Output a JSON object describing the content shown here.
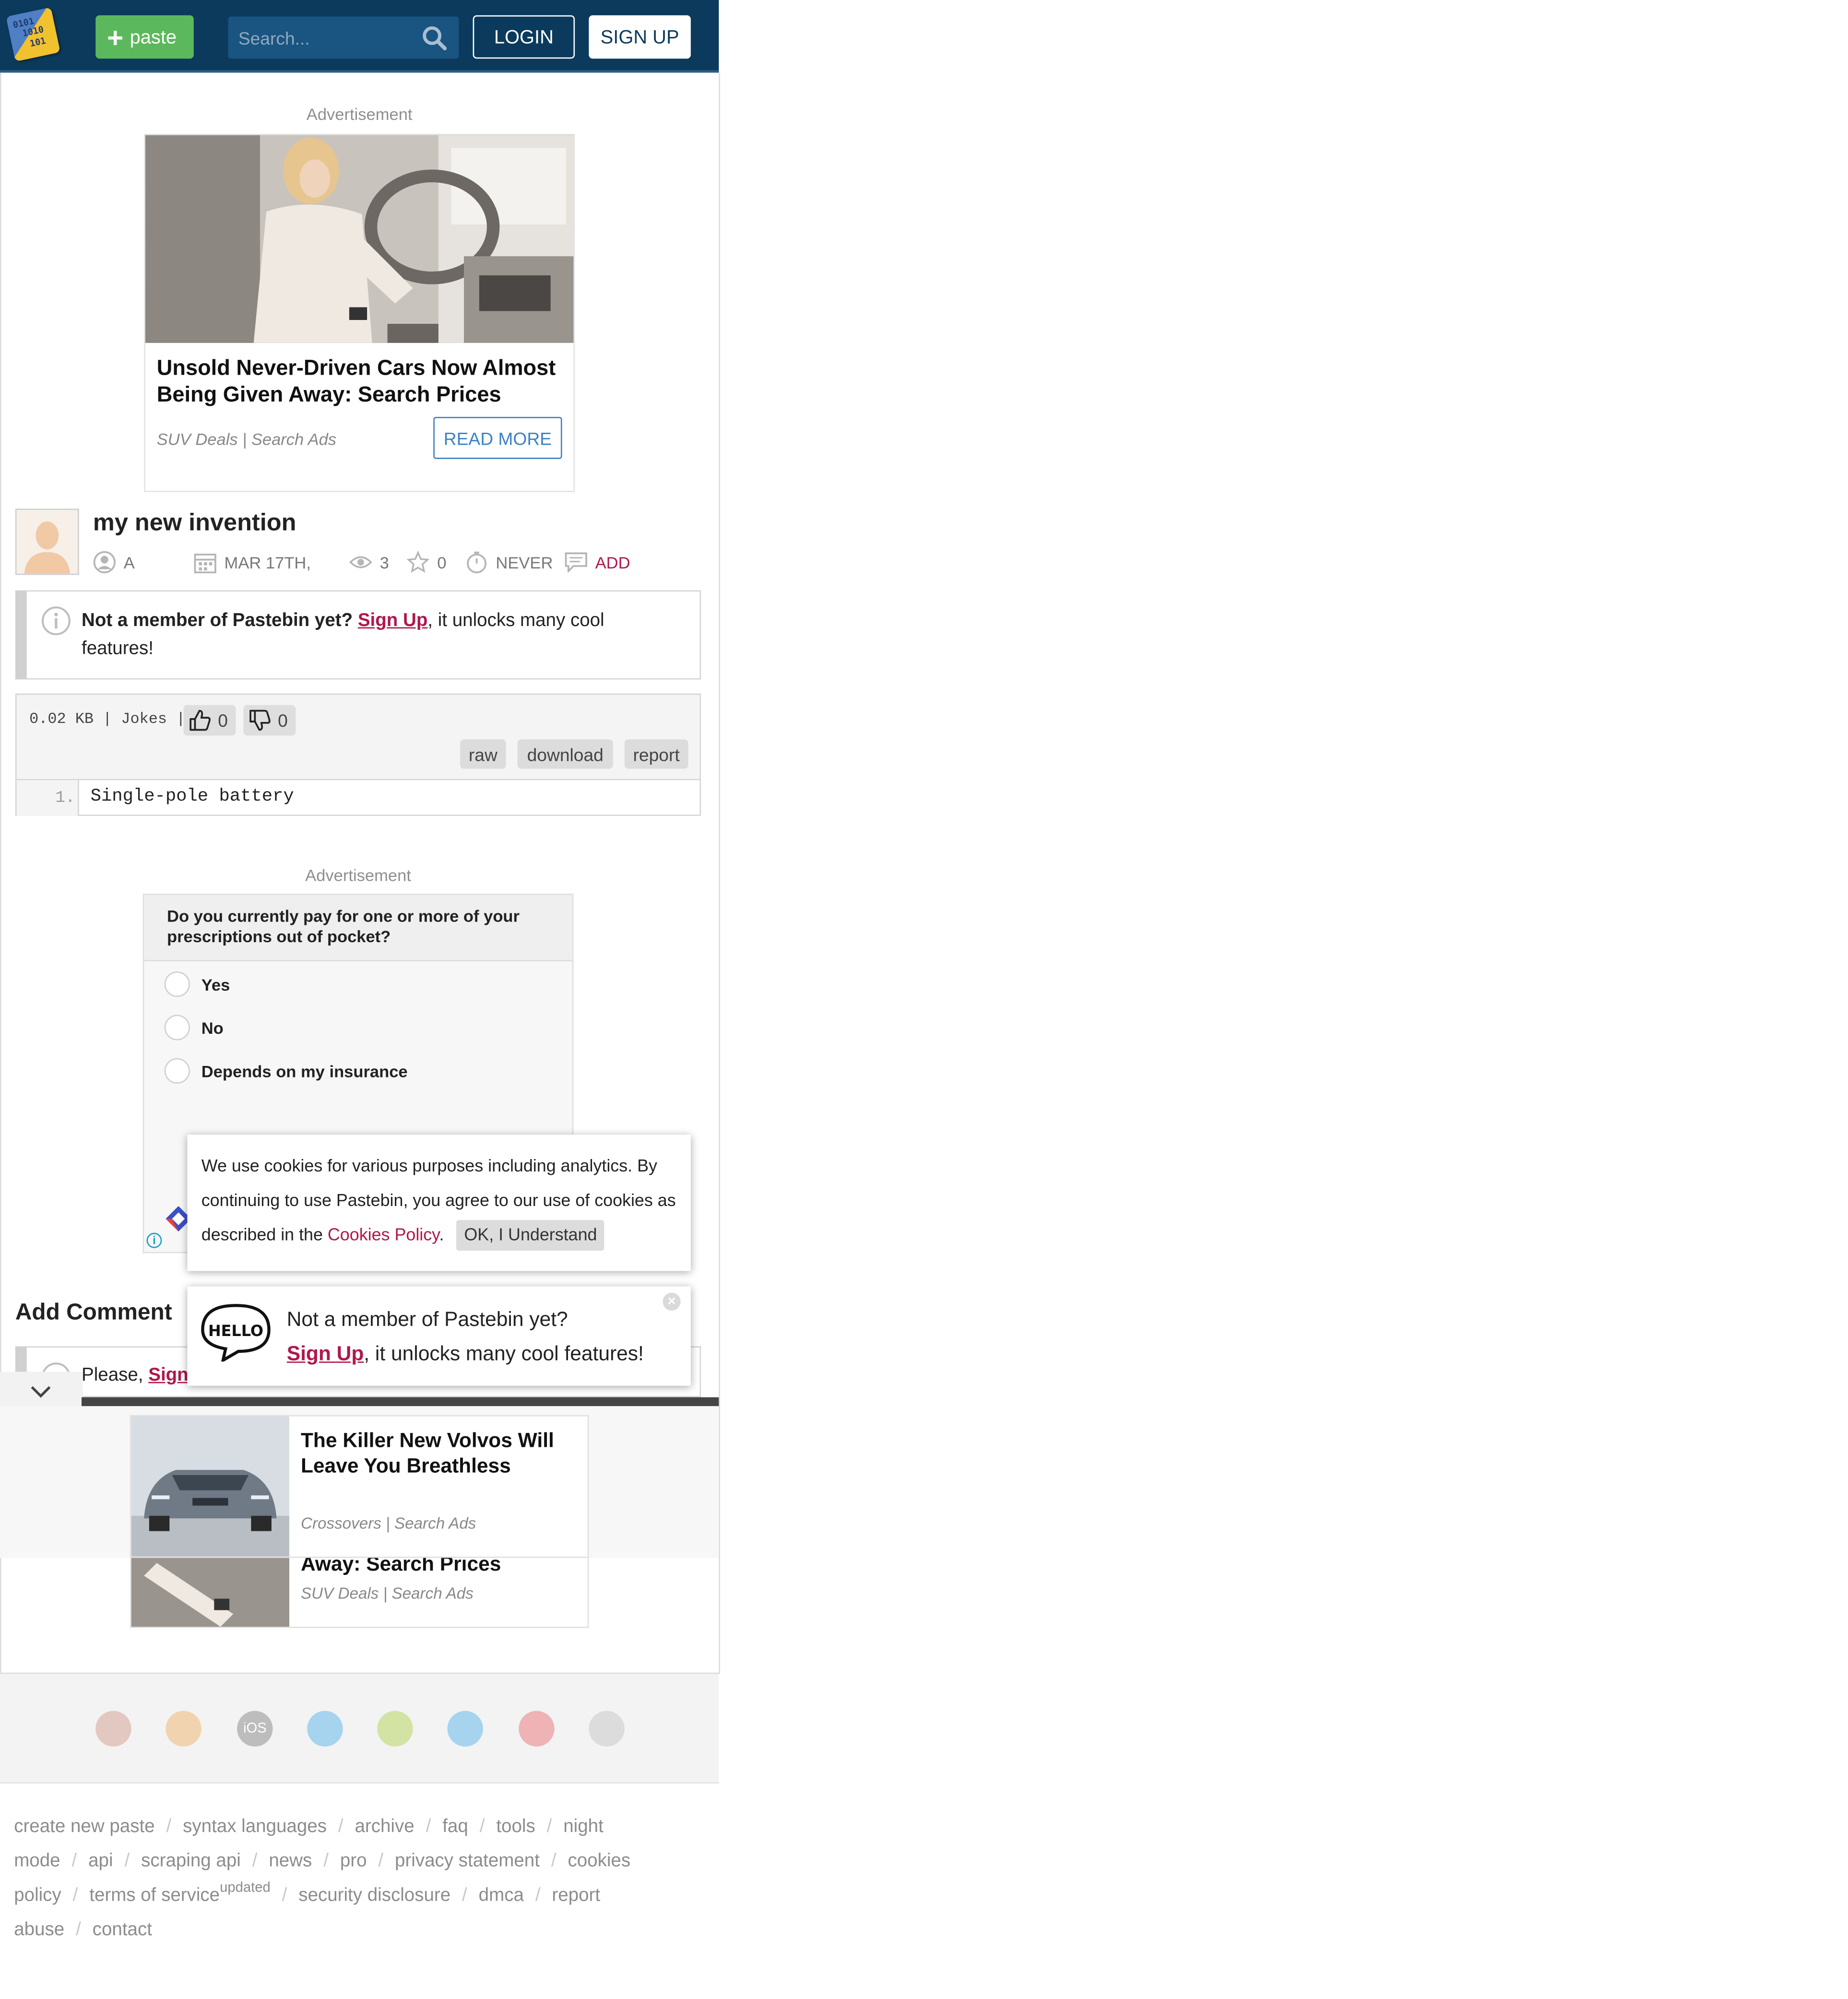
{
  "header": {
    "logo_lines": [
      "0101",
      "1010",
      "101"
    ],
    "paste_label": "paste",
    "search_placeholder": "Search...",
    "login_label": "LOGIN",
    "signup_label": "SIGN UP"
  },
  "ad_top": {
    "label": "Advertisement",
    "title": "Unsold Never-Driven Cars Now Almost Being Given Away: Search Prices",
    "source": "SUV Deals | Search Ads",
    "button": "READ MORE"
  },
  "paste": {
    "title": "my new invention",
    "author": "A",
    "date": "MAR 17TH,",
    "views": "3",
    "stars": "0",
    "expires": "NEVER",
    "comments_label": "ADD"
  },
  "member_notice": {
    "bold": "Not a member of Pastebin yet?",
    "link": "Sign Up",
    "rest": ", it unlocks many cool features!"
  },
  "code": {
    "stats": "0.02 KB | Jokes |",
    "likes": "0",
    "dislikes": "0",
    "raw_label": "raw",
    "download_label": "download",
    "report_label": "report",
    "lines": [
      {
        "number": "1.",
        "text": "Single-pole battery"
      }
    ]
  },
  "ad_poll": {
    "label": "Advertisement",
    "question": "Do you currently pay for one or more of your prescriptions out of pocket?",
    "options": [
      "Yes",
      "No",
      "Depends on my insurance"
    ]
  },
  "cookie": {
    "text_before": "We use cookies for various purposes including analytics. By continuing to use Pastebin, you agree to our use of cookies as described in the ",
    "policy_link": "Cookies Policy",
    "text_after": ".",
    "button": "OK, I Understand"
  },
  "comment": {
    "heading": "Add Comment",
    "prompt_before": "Please, ",
    "prompt_link": "Sign"
  },
  "hello_popup": {
    "bubble_text": "HELLO",
    "line1": "Not a member of Pastebin yet?",
    "link": "Sign Up",
    "line2_rest": ", it unlocks many cool features!",
    "close": "×"
  },
  "sticky_ads": [
    {
      "title": "The Killer New Volvos Will Leave You Breathless",
      "source": "Crossovers | Search Ads"
    },
    {
      "title": "Away: Search Prices",
      "source": "SUV Deals | Search Ads"
    }
  ],
  "browser_icons": [
    "chrome-icon",
    "firefox-icon",
    "ios-icon",
    "windows-icon",
    "android-icon",
    "mac-icon",
    "opera-icon",
    "linux-icon"
  ],
  "browser_icon_colors": [
    "#e2c8c0",
    "#f2d3b0",
    "#bdbdbd",
    "#a6d3ee",
    "#d3e3a3",
    "#a6d3ee",
    "#efb3b5",
    "#dcdcdc"
  ],
  "ios_label": "iOS",
  "footer": {
    "links": [
      "create new paste",
      "syntax languages",
      "archive",
      "faq",
      "tools",
      "night mode",
      "api",
      "scraping api",
      "news",
      "pro",
      "privacy statement",
      "cookies policy",
      "terms of service",
      "security disclosure",
      "dmca",
      "report abuse",
      "contact"
    ],
    "updated_badge": "updated"
  },
  "colors": {
    "header_bg": "#0b3a5c",
    "paste_button": "#5cb85c",
    "link_red": "#b0174c",
    "ad_button_blue": "#3b82c4"
  }
}
